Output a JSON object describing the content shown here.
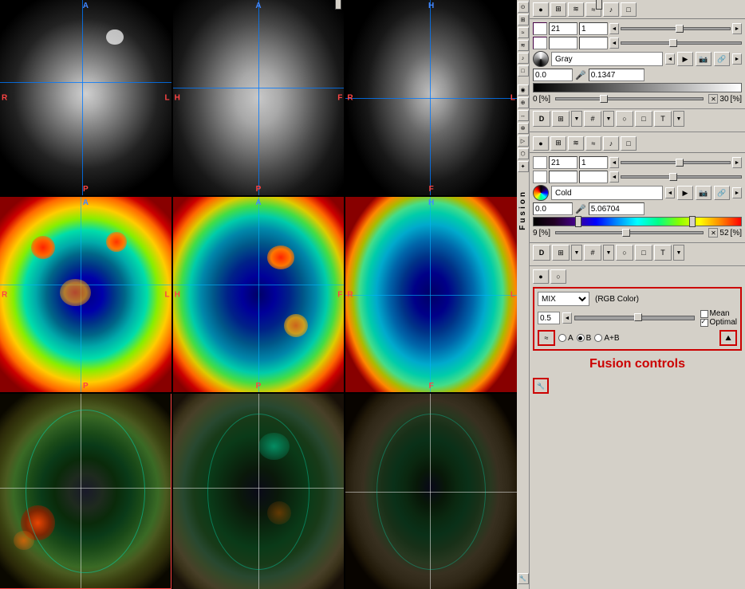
{
  "imageGrid": {
    "rows": [
      [
        "mri-axial-1",
        "mri-axial-2",
        "mri-coronal"
      ],
      [
        "pet-axial-1",
        "pet-axial-2",
        "pet-coronal"
      ],
      [
        "fusion-axial-1",
        "fusion-axial-2",
        "fusion-coronal"
      ]
    ],
    "labels": {
      "top": "A",
      "bottom": "P",
      "left": "R",
      "right": "L",
      "H": "H",
      "F": "F"
    }
  },
  "panel1": {
    "value1": "21",
    "value2": "1",
    "value3": "",
    "value4": "",
    "colormapName": "Gray",
    "minVal": "0.0",
    "maxVal": "0.1347",
    "percentMin": "0",
    "percentMinUnit": "[%]",
    "percentMax": "30",
    "percentMaxUnit": "[%]"
  },
  "panel2": {
    "value1": "21",
    "value2": "1",
    "value3": "",
    "value4": "",
    "colormapName": "Cold",
    "minVal": "0.0",
    "maxVal": "5.06704",
    "percentMin": "9",
    "percentMinUnit": "[%]",
    "percentMax": "52",
    "percentMaxUnit": "[%]"
  },
  "fusionPanel": {
    "title": "Fusion controls",
    "mixLabel": "MIX",
    "rgbLabel": "(RGB Color)",
    "sliderValue": "0.5",
    "checkboxes": {
      "mean": {
        "label": "Mean",
        "checked": false
      },
      "optimal": {
        "label": "Optimal",
        "checked": true
      }
    },
    "radioOptions": [
      "A",
      "B",
      "A+B"
    ],
    "selectedRadio": "B"
  },
  "icons": {
    "circle": "●",
    "grid": "⊞",
    "settings": "⚙",
    "wave": "≋",
    "note": "♪",
    "square": "□",
    "arrowLeft": "◄",
    "arrowRight": "►",
    "arrowDown": "▼",
    "mic": "🎤",
    "mountain": "⛰",
    "link": "🔗",
    "crosshair": "⊕",
    "play": "▶",
    "camera": "📷",
    "text": "T",
    "cube": "❑"
  }
}
